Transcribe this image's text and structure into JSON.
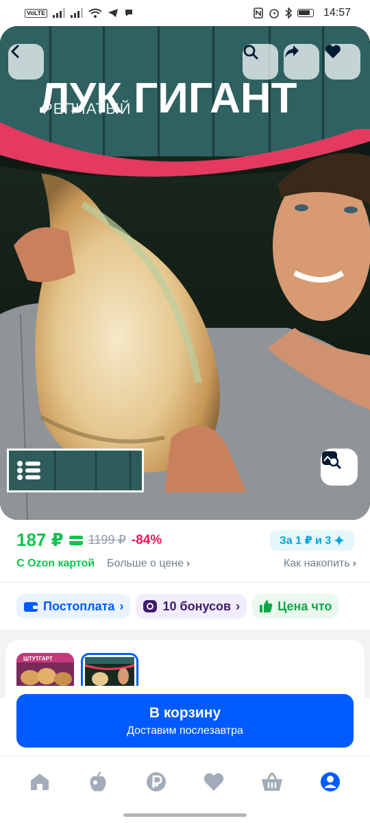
{
  "status_bar": {
    "volte": "VoLTE",
    "time": "14:57"
  },
  "hero": {
    "title": "ЛУК ГИГАНТ",
    "subtitle": "РЕПЧАТЫЙ"
  },
  "price": {
    "current": "187 ₽",
    "old": "1199 ₽",
    "discount": "-84%",
    "accumulate_chip": "За 1 ₽ и 3",
    "ozon_card_label": "С Ozon картой",
    "more_about_price": "Больше о цене",
    "how_to_accumulate": "Как накопить"
  },
  "chips": [
    {
      "label": "Постоплата",
      "icon": "wallet-icon"
    },
    {
      "label": "10 бонусов",
      "icon": "bonus-coin-icon"
    },
    {
      "label": "Цена что",
      "icon": "thumbs-up-icon"
    }
  ],
  "variants": {
    "variant_1_text": "ШТУТГАРТ"
  },
  "cart": {
    "label": "В корзину",
    "delivery": "Доставим послезавтра"
  },
  "bottom_nav": [
    "home-icon",
    "fresh-apple-icon",
    "ruble-icon",
    "heart-icon",
    "basket-icon",
    "profile-icon"
  ],
  "colors": {
    "brand_blue": "#005bff",
    "price_green": "#10c44c",
    "discount_pink": "#f91155",
    "accumulate_cyan": "#00a3d9"
  }
}
